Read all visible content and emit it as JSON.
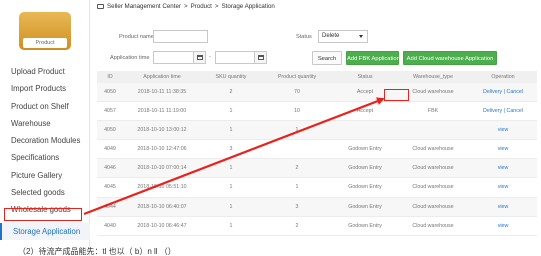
{
  "logo": {
    "text": "Product"
  },
  "sidebar": {
    "items": [
      {
        "label": "Upload Product"
      },
      {
        "label": "Import Products"
      },
      {
        "label": "Product on Shelf"
      },
      {
        "label": "Warehouse"
      },
      {
        "label": "Decoration Modules"
      },
      {
        "label": "Specifications"
      },
      {
        "label": "Picture Gallery"
      },
      {
        "label": "Selected goods"
      },
      {
        "label": "Wholesale goods"
      },
      {
        "label": "Storage Application"
      }
    ],
    "active_index": 9
  },
  "breadcrumb": {
    "root": "Seller Management Center",
    "sep1": ">",
    "mid": "Product",
    "sep2": ">",
    "current": "Storage Application"
  },
  "filter": {
    "product_name_label": "Product name",
    "product_name_value": "",
    "status_label": "Status",
    "status_value": "Delete",
    "application_time_label": "Application time",
    "date_separator": "-",
    "search_button": "Search",
    "add_fbk_button": "Add FBK Application",
    "add_cloud_button": "Add Cloud warehouse Application"
  },
  "table": {
    "headers": [
      "ID",
      "Application time",
      "SKU quantity",
      "Product quantity",
      "Status",
      "Warehouse_type",
      "Operation"
    ],
    "rows": [
      {
        "id": "4050",
        "time": "2018-10-11 11:38:35",
        "sku": "2",
        "qty": "70",
        "status": "Accept",
        "warehouse": "Cloud warehouse",
        "op1": "Delivery",
        "sep": "|",
        "op2": "Cancel"
      },
      {
        "id": "4057",
        "time": "2018-10-11 11:19:00",
        "sku": "1",
        "qty": "10",
        "status": "Accept",
        "warehouse": "FBK",
        "op1": "Delivery",
        "sep": "|",
        "op2": "Cancel"
      },
      {
        "id": "4050",
        "time": "2018-10-10 13:00:12",
        "sku": "1",
        "qty": "1",
        "status": "",
        "warehouse": "",
        "op1": "view",
        "sep": "",
        "op2": ""
      },
      {
        "id": "4049",
        "time": "2018-10-10 12:47:06",
        "sku": "3",
        "qty": "",
        "status": "Godown Entry",
        "warehouse": "Cloud warehouse",
        "op1": "view",
        "sep": "",
        "op2": ""
      },
      {
        "id": "4046",
        "time": "2018-10-10 07:00:14",
        "sku": "1",
        "qty": "2",
        "status": "Godown Entry",
        "warehouse": "Cloud warehouse",
        "op1": "view",
        "sep": "",
        "op2": ""
      },
      {
        "id": "4045",
        "time": "2018-10-10 05:51:10",
        "sku": "1",
        "qty": "1",
        "status": "Godown Entry",
        "warehouse": "Cloud warehouse",
        "op1": "view",
        "sep": "",
        "op2": ""
      },
      {
        "id": "4044",
        "time": "2018-10-10 06:40:07",
        "sku": "1",
        "qty": "3",
        "status": "Godown Entry",
        "warehouse": "Cloud warehouse",
        "op1": "view",
        "sep": "",
        "op2": ""
      },
      {
        "id": "4040",
        "time": "2018-10-10 06:46:47",
        "sku": "1",
        "qty": "2",
        "status": "Godown Entry",
        "warehouse": "Cloud warehouse",
        "op1": "view",
        "sep": "",
        "op2": ""
      }
    ]
  },
  "annotation": {
    "bottom_text": "（2）待流产成品能先：tl    也以（    b）n    ll    （）",
    "highlight_color": "#e8231d"
  }
}
